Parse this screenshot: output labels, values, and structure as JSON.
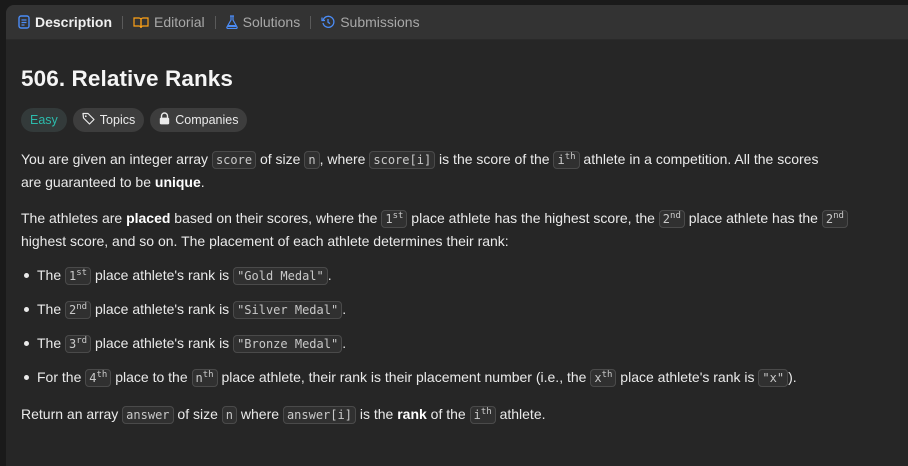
{
  "tabs": [
    {
      "label": "Description",
      "icon": "description-icon"
    },
    {
      "label": "Editorial",
      "icon": "book-icon"
    },
    {
      "label": "Solutions",
      "icon": "flask-icon"
    },
    {
      "label": "Submissions",
      "icon": "history-icon"
    }
  ],
  "problem": {
    "title": "506. Relative Ranks",
    "difficulty": "Easy",
    "topics_label": "Topics",
    "companies_label": "Companies"
  },
  "para1": {
    "t1": "You are given an integer array ",
    "c1": "score",
    "t2": " of size ",
    "c2": "n",
    "t3": ", where ",
    "c3": "score[i]",
    "t4": " is the score of the ",
    "c4": "i",
    "s4": "th",
    "t5": " athlete in a competition. All the scores are guaranteed to be ",
    "b1": "unique",
    "t6": "."
  },
  "para2": {
    "t1": "The athletes are ",
    "b1": "placed",
    "t2": " based on their scores, where the ",
    "c1": "1",
    "s1": "st",
    "t3": " place athlete has the highest score, the ",
    "c2": "2",
    "s2": "nd",
    "t4": " place athlete has the ",
    "c3": "2",
    "s3": "nd",
    "t5": " highest score, and so on. The placement of each athlete determines their rank:"
  },
  "bullets": {
    "b1": {
      "t1": "The ",
      "c1": "1",
      "s1": "st",
      "t2": " place athlete's rank is ",
      "c2": "\"Gold Medal\"",
      "t3": "."
    },
    "b2": {
      "t1": "The ",
      "c1": "2",
      "s1": "nd",
      "t2": " place athlete's rank is ",
      "c2": "\"Silver Medal\"",
      "t3": "."
    },
    "b3": {
      "t1": "The ",
      "c1": "3",
      "s1": "rd",
      "t2": " place athlete's rank is ",
      "c2": "\"Bronze Medal\"",
      "t3": "."
    },
    "b4": {
      "t1": "For the ",
      "c1": "4",
      "s1": "th",
      "t2": " place to the ",
      "c2": "n",
      "s2": "th",
      "t3": " place athlete, their rank is their placement number (i.e., the ",
      "c3": "x",
      "s3": "th",
      "t4": " place athlete's rank is ",
      "c4": "\"x\"",
      "t5": ")."
    }
  },
  "para3": {
    "t1": "Return an array ",
    "c1": "answer",
    "t2": " of size ",
    "c2": "n",
    "t3": " where ",
    "c3": "answer[i]",
    "t4": " is the ",
    "b1": "rank",
    "t5": " of the ",
    "c4": "i",
    "s4": "th",
    "t6": " athlete."
  },
  "colors": {
    "accent": "#4b8cf6",
    "easy": "#2cbbac",
    "panel": "#262626",
    "tabbar": "#333333"
  }
}
